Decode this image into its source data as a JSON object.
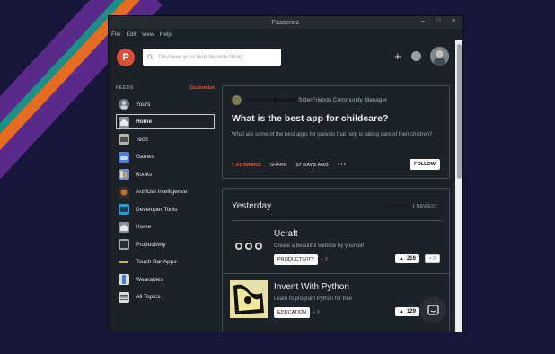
{
  "window": {
    "title": "Passerine",
    "controls": [
      "–",
      "□",
      "×"
    ]
  },
  "menu": [
    "File",
    "Edit",
    "View",
    "Help"
  ],
  "search": {
    "placeholder": "Discover your next favorite thing..."
  },
  "logo_letter": "P",
  "sidebar": {
    "heading": "FEEDS",
    "customize": "Customize",
    "items": [
      {
        "label": "Yours",
        "icon": "avatar-icon"
      },
      {
        "label": "Home",
        "icon": "home-icon",
        "active": true
      },
      {
        "label": "Tech",
        "icon": "tech-icon"
      },
      {
        "label": "Games",
        "icon": "games-icon"
      },
      {
        "label": "Books",
        "icon": "books-icon"
      },
      {
        "label": "Artificial Intelligence",
        "icon": "ai-icon"
      },
      {
        "label": "Developer Tools",
        "icon": "developer-tools-icon"
      },
      {
        "label": "Home",
        "icon": "home-icon"
      },
      {
        "label": "Productivity",
        "icon": "productivity-icon"
      },
      {
        "label": "Touch Bar Apps",
        "icon": "touch-bar-icon"
      },
      {
        "label": "Wearables",
        "icon": "wearables-icon"
      },
      {
        "label": "All Topics",
        "icon": "list-icon"
      }
    ]
  },
  "question": {
    "author": "Shannon Bracken",
    "role": "SitterFriends Community Manager",
    "title": "What is the best app for childcare?",
    "description": "What are some of the best apps for parents that help in taking care of their children?",
    "answers": "7 ANSWERS",
    "share": "SHARE",
    "ago": "17 DAYS AGO",
    "more": "•••",
    "follow": "FOLLOW"
  },
  "feed": {
    "heading": "Yesterday",
    "sort_popular": "POPULAR",
    "sort_sep": "|",
    "sort_newest": "NEWEST",
    "products": [
      {
        "name": "Ucraft",
        "tagline": "Create a beautiful website by yourself",
        "tag": "PRODUCTIVITY",
        "more": "+ 3",
        "votes": "216",
        "comments": "8"
      },
      {
        "name": "Invent With Python",
        "tagline": "Learn to program Python for free",
        "tag": "EDUCATION",
        "more": "+ 3",
        "votes": "129"
      }
    ]
  },
  "colors": {
    "accent": "#dc4f35",
    "bg": "#1d2128",
    "desktop": "#17163a"
  }
}
